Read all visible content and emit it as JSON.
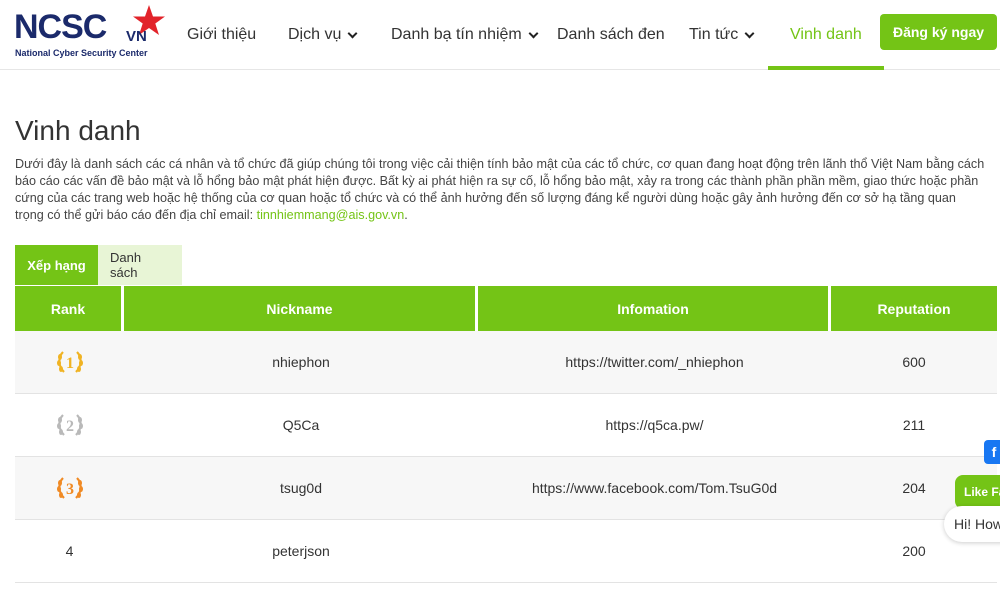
{
  "brand": {
    "logo_main": "NCSC",
    "logo_vn": "VN",
    "logo_sub": "National Cyber Security Center",
    "accent": "#74c416",
    "navy": "#1b2a6b",
    "star": "#e2232a"
  },
  "nav": {
    "items": [
      {
        "label": "Giới thiệu",
        "dropdown": false
      },
      {
        "label": "Dịch vụ",
        "dropdown": true
      },
      {
        "label": "Danh bạ tín nhiệm",
        "dropdown": true
      },
      {
        "label": "Danh sách đen",
        "dropdown": false
      },
      {
        "label": "Tin tức",
        "dropdown": true
      },
      {
        "label": "Vinh danh",
        "dropdown": false,
        "active": true
      }
    ],
    "register_label": "Đăng ký ngay"
  },
  "page": {
    "title": "Vinh danh",
    "intro": "Dưới đây là danh sách các cá nhân và tổ chức đã giúp chúng tôi trong việc cải thiện tính bảo mật của các tổ chức, cơ quan đang hoạt động trên lãnh thổ Việt Nam bằng cách báo cáo các vấn đề bảo mật và lỗ hổng bảo mật phát hiện được. Bất kỳ ai phát hiện ra sự cố, lỗ hổng bảo mật, xảy ra trong các thành phần phần mềm, giao thức hoặc phần cứng của các trang web hoặc hệ thống của cơ quan hoặc tổ chức và có thể ảnh hưởng đến số lượng đáng kể người dùng hoặc gây ảnh hưởng đến cơ sở hạ tầng quan trọng có thể gửi báo cáo đến địa chỉ email: ",
    "email": "tinnhiemmang@ais.gov.vn",
    "intro_end": "."
  },
  "tabs": [
    {
      "label": "Xếp hạng",
      "active": true
    },
    {
      "label": "Danh sách",
      "active": false
    }
  ],
  "table": {
    "columns": [
      "Rank",
      "Nickname",
      "Infomation",
      "Reputation"
    ],
    "rows": [
      {
        "rank": "1",
        "medal": "gold",
        "nickname": "nhiephon",
        "info": "https://twitter.com/_nhiephon",
        "reputation": "600"
      },
      {
        "rank": "2",
        "medal": "silver",
        "nickname": "Q5Ca",
        "info": "https://q5ca.pw/",
        "reputation": "211"
      },
      {
        "rank": "3",
        "medal": "bronze",
        "nickname": "tsug0d",
        "info": "https://www.facebook.com/Tom.TsuG0d",
        "reputation": "204"
      },
      {
        "rank": "4",
        "medal": "",
        "nickname": "peterjson",
        "info": "",
        "reputation": "200"
      }
    ],
    "medal_colors": {
      "gold": "#f0b323",
      "silver": "#b9b9b9",
      "bronze": "#f08a24"
    }
  },
  "widgets": {
    "fb_letter": "f",
    "like_label": "Like Fa",
    "chat_greeting": "Hi! How"
  }
}
